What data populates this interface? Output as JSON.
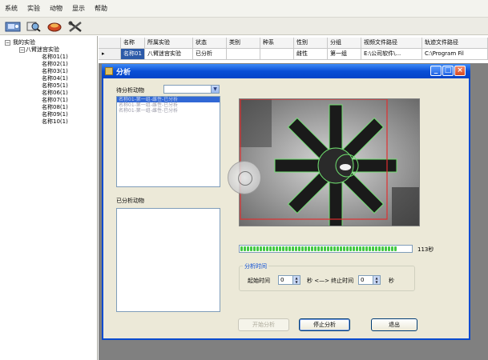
{
  "menu": [
    "系统",
    "实验",
    "动物",
    "显示",
    "帮助"
  ],
  "toolbar_icons": [
    "camera-icon",
    "search-icon",
    "record-icon",
    "tools-icon"
  ],
  "tree": {
    "root": "我的实验",
    "experiment": "八臂迷宫实验",
    "animals": [
      "名称01(1)",
      "名称02(1)",
      "名称03(1)",
      "名称04(1)",
      "名称05(1)",
      "名称06(1)",
      "名称07(1)",
      "名称08(1)",
      "名称09(1)",
      "名称10(1)"
    ]
  },
  "grid": {
    "columns": [
      "名称",
      "所属实验",
      "状态",
      "类别",
      "种系",
      "性别",
      "分组",
      "视频文件路径",
      "轨迹文件路径"
    ],
    "row": [
      "名称01",
      "八臂迷宫实验",
      "已分析",
      "",
      "",
      "雌性",
      "第一组",
      "E:\\公司软件\\...",
      "C:\\Program Fil"
    ]
  },
  "dialog": {
    "title": "分析",
    "pending_label": "待分析动物",
    "pending_items": [
      "名称01-第一组-雌性-已分析",
      "名称01-第一组-雌性-已分析",
      "名称01-第一组-雌性-已分析"
    ],
    "analyzed_label": "已分析动物",
    "progress_value": 0.95,
    "progress_text": "113秒",
    "time_group_title": "分析时间",
    "start_label": "起始时间",
    "start_value": "0",
    "mid_label": "秒 <—> 终止时间",
    "end_value": "0",
    "end_unit": "秒",
    "btn_start": "开始分析",
    "btn_stop": "停止分析",
    "btn_exit": "退出"
  }
}
